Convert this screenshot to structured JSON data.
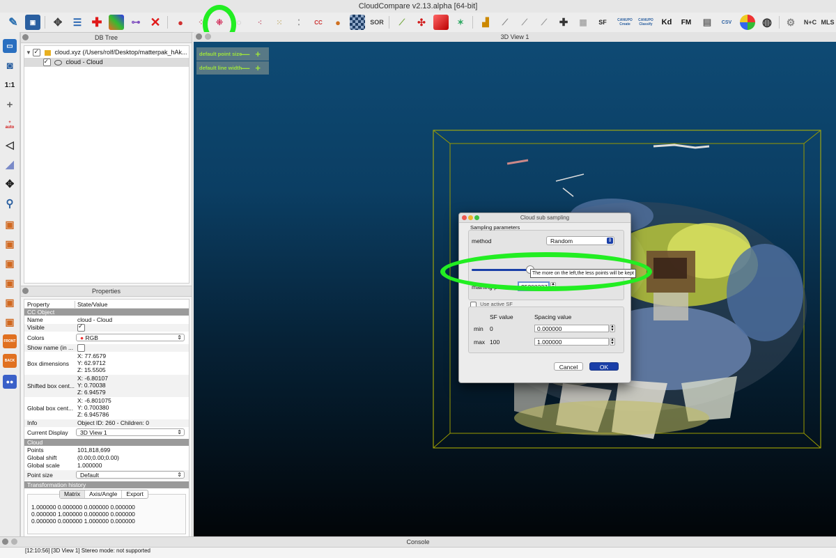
{
  "app": {
    "title": "CloudCompare v2.13.alpha [64-bit]"
  },
  "toolbar": {
    "icons": [
      "open-icon",
      "save-icon",
      "settings-icon",
      "list-icon",
      "merge-icon",
      "scalar-icon",
      "clone-icon",
      "delete-icon",
      "sample-icon",
      "subsample-icon",
      "filter-icon",
      "crop-icon",
      "cc-icon",
      "drop-icon",
      "checker-icon",
      "sor-icon",
      "pick-icon",
      "translate-icon",
      "segment-icon",
      "align-icon",
      "stat-icon",
      "edit-icon",
      "compare-icon",
      "plus-icon",
      "grid-icon",
      "sf-icon",
      "canupo-create-icon",
      "canupo-classify-icon",
      "kd-icon",
      "fm-icon",
      "export-icon",
      "csv-icon",
      "color-icon",
      "globe-icon",
      "gear-icon",
      "n-c-icon",
      "mls-icon"
    ],
    "sor_label": "SOR",
    "sf_label": "SF",
    "canupo_label": "CANUPO",
    "create_label": "Create",
    "classify_label": "Classify",
    "kd_label": "Kd",
    "fm_label": "FM",
    "csv_label": "CSV",
    "nc_label": "N+C",
    "mls_label": "MLS"
  },
  "left_icons": {
    "one_to_one": "1:1",
    "auto": "auto",
    "front": "FRONT",
    "back": "BACK"
  },
  "db_tree": {
    "title": "DB Tree",
    "root_label": "cloud.xyz (/Users/rolf/Desktop/matterpak_hAk...",
    "child_label": "cloud - Cloud"
  },
  "properties": {
    "title": "Properties",
    "col_property": "Property",
    "col_value": "State/Value",
    "section_cc": "CC Object",
    "name_k": "Name",
    "name_v": "cloud - Cloud",
    "visible_k": "Visible",
    "colors_k": "Colors",
    "colors_v": "RGB",
    "showname_k": "Show name (in ...",
    "boxdim_k": "Box dimensions",
    "boxdim_x": "X: 77.6579",
    "boxdim_y": "Y: 62.9712",
    "boxdim_z": "Z: 15.5505",
    "shifted_k": "Shifted box cent...",
    "shifted_x": "X: -6.80107",
    "shifted_y": "Y: 0.70038",
    "shifted_z": "Z: 6.94579",
    "global_k": "Global box cent...",
    "global_x": "X: -6.801075",
    "global_y": "Y: 0.700380",
    "global_z": "Z: 6.945786",
    "info_k": "Info",
    "info_v": "Object ID: 260 - Children: 0",
    "display_k": "Current Display",
    "display_v": "3D View 1",
    "section_cloud": "Cloud",
    "points_k": "Points",
    "points_v": "101,818,699",
    "gshift_k": "Global shift",
    "gshift_v": "(0.00;0.00;0.00)",
    "gscale_k": "Global scale",
    "gscale_v": "1.000000",
    "psize_k": "Point size",
    "psize_v": "Default",
    "section_transform": "Transformation history",
    "tab_matrix": "Matrix",
    "tab_axis": "Axis/Angle",
    "tab_export": "Export",
    "matrix_rows": [
      "1.000000 0.000000 0.000000 0.000000",
      "0.000000 1.000000 0.000000 0.000000",
      "0.000000 0.000000 1.000000 0.000000"
    ]
  },
  "view": {
    "title": "3D View 1",
    "default_point_size": "default point size",
    "default_line_width": "default line width",
    "minus": "—",
    "plus": "+"
  },
  "dialog": {
    "title": "Cloud sub sampling",
    "group_label": "Sampling parameters",
    "method_label": "method",
    "method_value": "Random",
    "slider_position": 0.42,
    "tooltip": "The more on the left,the less points will be kept",
    "remaining_label": "maining points",
    "remaining_value": "35208337",
    "use_sf_label": "Use active SF",
    "sf_value_header": "SF value",
    "spacing_header": "Spacing value",
    "min_label": "min",
    "min_sf": "0",
    "min_spacing": "0.000000",
    "max_label": "max",
    "max_sf": "100",
    "max_spacing": "1.000000",
    "cancel": "Cancel",
    "ok": "OK"
  },
  "console": {
    "title": "Console",
    "line": "[12:10:56] [3D View 1] Stereo mode: not supported"
  },
  "colors": {
    "highlight": "#22ee22",
    "accent": "#1a3fa8",
    "view_top": "#0e4a74"
  }
}
